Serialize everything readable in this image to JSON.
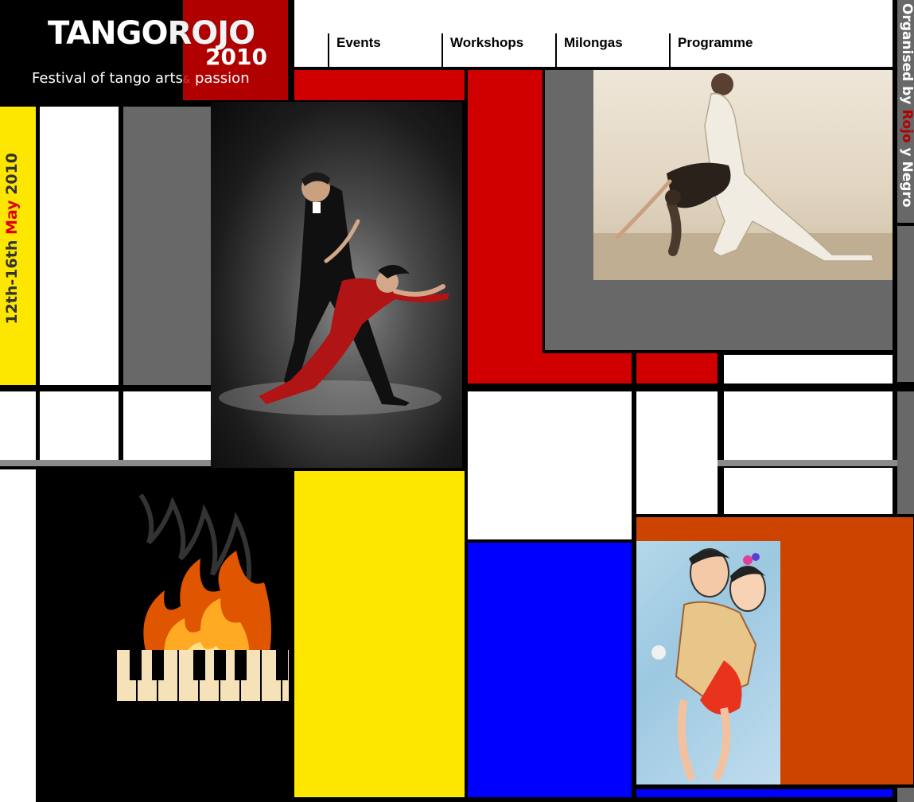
{
  "header": {
    "logo_a": "TANGO",
    "logo_b": "ROJO",
    "logo_year": "2010",
    "tagline_start": "Festival of tango arts",
    "tagline_amp": "&",
    "tagline_end": " passion"
  },
  "nav": {
    "items": [
      {
        "label": "Events"
      },
      {
        "label": "Workshops"
      },
      {
        "label": "Milongas"
      },
      {
        "label": "Programme"
      }
    ]
  },
  "organiser": {
    "prefix": "Organised by ",
    "rojo": "Rojo",
    "suffix": " y Negro"
  },
  "dates": {
    "range": "12th-16th ",
    "month": "May",
    "year": " 2010"
  },
  "colors": {
    "red": "#d00000",
    "yellow": "#fde700",
    "blue": "#0000ff",
    "orange": "#cc4400",
    "gray": "#686868"
  }
}
